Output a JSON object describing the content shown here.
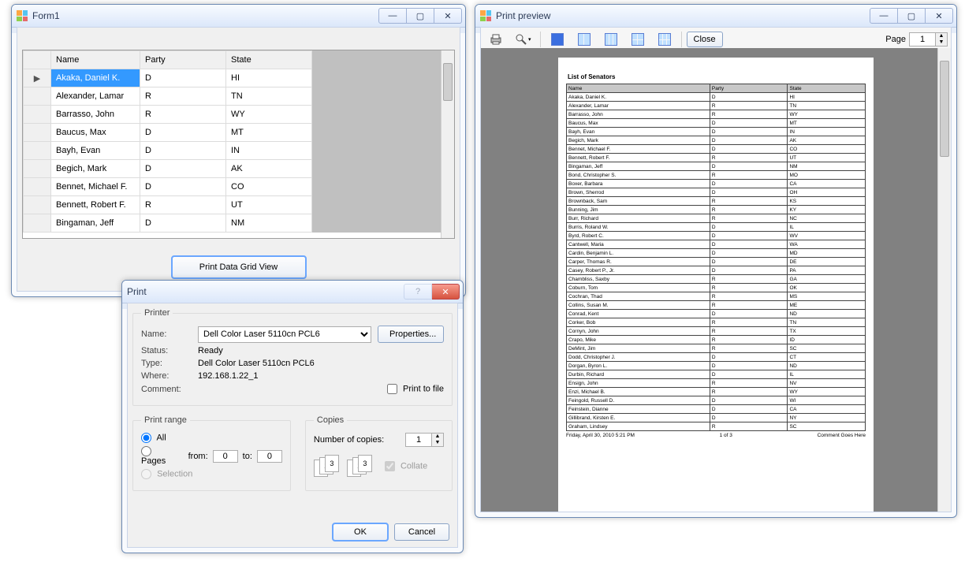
{
  "form1": {
    "title": "Form1",
    "headers": {
      "name": "Name",
      "party": "Party",
      "state": "State"
    },
    "rows": [
      {
        "name": "Akaka, Daniel K.",
        "party": "D",
        "state": "HI"
      },
      {
        "name": "Alexander, Lamar",
        "party": "R",
        "state": "TN"
      },
      {
        "name": "Barrasso, John",
        "party": "R",
        "state": "WY"
      },
      {
        "name": "Baucus, Max",
        "party": "D",
        "state": "MT"
      },
      {
        "name": "Bayh, Evan",
        "party": "D",
        "state": "IN"
      },
      {
        "name": "Begich, Mark",
        "party": "D",
        "state": "AK"
      },
      {
        "name": "Bennet, Michael F.",
        "party": "D",
        "state": "CO"
      },
      {
        "name": "Bennett, Robert F.",
        "party": "R",
        "state": "UT"
      },
      {
        "name": "Bingaman, Jeff",
        "party": "D",
        "state": "NM"
      }
    ],
    "selected_row": 0,
    "print_grid_button": "Print Data Grid View"
  },
  "printdlg": {
    "title": "Print",
    "printer": {
      "legend": "Printer",
      "name_label": "Name:",
      "name_value": "Dell Color Laser 5110cn PCL6",
      "properties_button": "Properties...",
      "status_label": "Status:",
      "status_value": "Ready",
      "type_label": "Type:",
      "type_value": "Dell Color Laser 5110cn PCL6",
      "where_label": "Where:",
      "where_value": "192.168.1.22_1",
      "comment_label": "Comment:",
      "comment_value": "",
      "print_to_file": "Print to file"
    },
    "range": {
      "legend": "Print range",
      "all": "All",
      "pages": "Pages",
      "from": "from:",
      "to": "to:",
      "from_value": "0",
      "to_value": "0",
      "selection": "Selection"
    },
    "copies": {
      "legend": "Copies",
      "number_label": "Number of copies:",
      "number_value": "1",
      "collate": "Collate"
    },
    "ok": "OK",
    "cancel": "Cancel"
  },
  "preview": {
    "title": "Print preview",
    "close": "Close",
    "page_label": "Page",
    "page_value": "1",
    "report_title": "List of Senators",
    "cols": {
      "name": "Name",
      "party": "Party",
      "state": "State"
    },
    "rows": [
      {
        "name": "Akaka, Daniel K.",
        "party": "D",
        "state": "HI"
      },
      {
        "name": "Alexander, Lamar",
        "party": "R",
        "state": "TN"
      },
      {
        "name": "Barrasso, John",
        "party": "R",
        "state": "WY"
      },
      {
        "name": "Baucus, Max",
        "party": "D",
        "state": "MT"
      },
      {
        "name": "Bayh, Evan",
        "party": "D",
        "state": "IN"
      },
      {
        "name": "Begich, Mark",
        "party": "D",
        "state": "AK"
      },
      {
        "name": "Bennet, Michael F.",
        "party": "D",
        "state": "CO"
      },
      {
        "name": "Bennett, Robert F.",
        "party": "R",
        "state": "UT"
      },
      {
        "name": "Bingaman, Jeff",
        "party": "D",
        "state": "NM"
      },
      {
        "name": "Bond, Christopher S.",
        "party": "R",
        "state": "MO"
      },
      {
        "name": "Boxer, Barbara",
        "party": "D",
        "state": "CA"
      },
      {
        "name": "Brown, Sherrod",
        "party": "D",
        "state": "OH"
      },
      {
        "name": "Brownback, Sam",
        "party": "R",
        "state": "KS"
      },
      {
        "name": "Bunning, Jim",
        "party": "R",
        "state": "KY"
      },
      {
        "name": "Burr, Richard",
        "party": "R",
        "state": "NC"
      },
      {
        "name": "Burris, Roland W.",
        "party": "D",
        "state": "IL"
      },
      {
        "name": "Byrd, Robert C.",
        "party": "D",
        "state": "WV"
      },
      {
        "name": "Cantwell, Maria",
        "party": "D",
        "state": "WA"
      },
      {
        "name": "Cardin, Benjamin L.",
        "party": "D",
        "state": "MD"
      },
      {
        "name": "Carper, Thomas R.",
        "party": "D",
        "state": "DE"
      },
      {
        "name": "Casey, Robert P., Jr.",
        "party": "D",
        "state": "PA"
      },
      {
        "name": "Chambliss, Saxby",
        "party": "R",
        "state": "GA"
      },
      {
        "name": "Coburn, Tom",
        "party": "R",
        "state": "OK"
      },
      {
        "name": "Cochran, Thad",
        "party": "R",
        "state": "MS"
      },
      {
        "name": "Collins, Susan M.",
        "party": "R",
        "state": "ME"
      },
      {
        "name": "Conrad, Kent",
        "party": "D",
        "state": "ND"
      },
      {
        "name": "Corker, Bob",
        "party": "R",
        "state": "TN"
      },
      {
        "name": "Cornyn, John",
        "party": "R",
        "state": "TX"
      },
      {
        "name": "Crapo, Mike",
        "party": "R",
        "state": "ID"
      },
      {
        "name": "DeMint, Jim",
        "party": "R",
        "state": "SC"
      },
      {
        "name": "Dodd, Christopher J.",
        "party": "D",
        "state": "CT"
      },
      {
        "name": "Dorgan, Byron L.",
        "party": "D",
        "state": "ND"
      },
      {
        "name": "Durbin, Richard",
        "party": "D",
        "state": "IL"
      },
      {
        "name": "Ensign, John",
        "party": "R",
        "state": "NV"
      },
      {
        "name": "Enzi, Michael B.",
        "party": "R",
        "state": "WY"
      },
      {
        "name": "Feingold, Russell D.",
        "party": "D",
        "state": "WI"
      },
      {
        "name": "Feinstein, Dianne",
        "party": "D",
        "state": "CA"
      },
      {
        "name": "Gillibrand, Kirsten E.",
        "party": "D",
        "state": "NY"
      },
      {
        "name": "Graham, Lindsey",
        "party": "R",
        "state": "SC"
      }
    ],
    "footer_left": "Friday, April 30, 2010 5:21 PM",
    "footer_center": "1 of 3",
    "footer_right": "Comment Goes Here"
  }
}
